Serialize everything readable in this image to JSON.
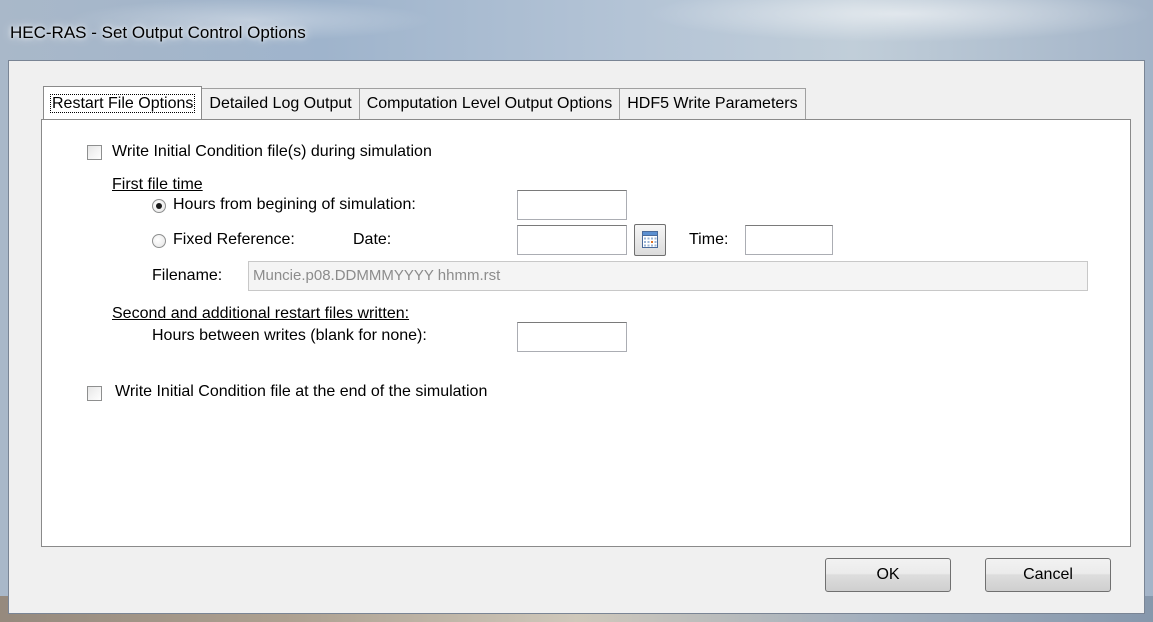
{
  "window": {
    "title": "HEC-RAS - Set Output Control Options"
  },
  "tabs": [
    {
      "label": "Restart File Options",
      "active": true
    },
    {
      "label": "Detailed Log Output",
      "active": false
    },
    {
      "label": "Computation Level Output Options",
      "active": false
    },
    {
      "label": "HDF5 Write Parameters",
      "active": false
    }
  ],
  "restart": {
    "write_ic_during_sim": {
      "label": "Write Initial Condition file(s) during simulation",
      "checked": false
    },
    "first_file_time_label": "First file time",
    "hours_from_beginning": {
      "label": "Hours from begining of simulation:",
      "selected": true,
      "value": ""
    },
    "fixed_reference": {
      "label": "Fixed Reference:",
      "selected": false
    },
    "date_label": "Date:",
    "date_value": "",
    "time_label": "Time:",
    "time_value": "",
    "filename_label": "Filename:",
    "filename_value": "Muncie.p08.DDMMMYYYY hhmm.rst",
    "second_files_label": "Second and additional restart files written:",
    "hours_between_label": "Hours between writes (blank for none):",
    "hours_between_value": "",
    "write_ic_end": {
      "label": "Write Initial Condition file at the end of the simulation",
      "checked": false
    }
  },
  "buttons": {
    "ok": "OK",
    "cancel": "Cancel"
  }
}
